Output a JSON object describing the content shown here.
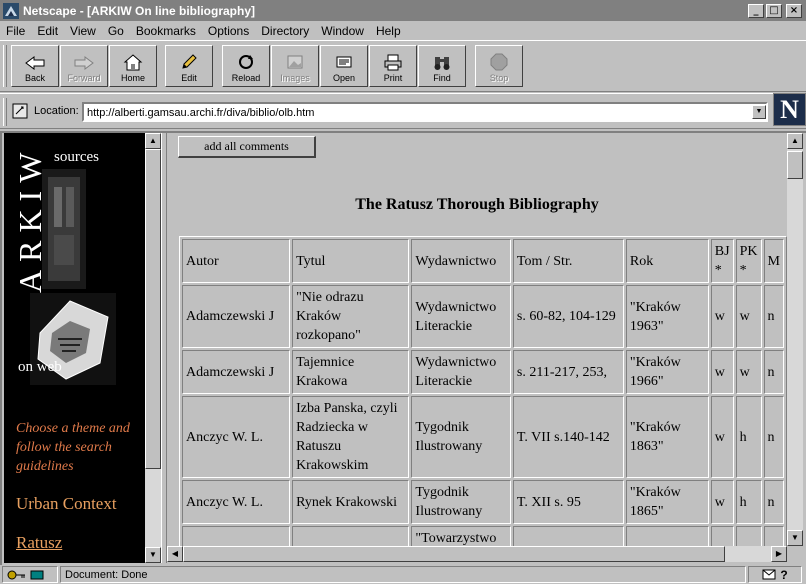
{
  "window": {
    "title": "Netscape - [ARKIW On line bibliography]",
    "min": "_",
    "max": "□",
    "close": "×"
  },
  "menu": [
    "File",
    "Edit",
    "View",
    "Go",
    "Bookmarks",
    "Options",
    "Directory",
    "Window",
    "Help"
  ],
  "toolbar": {
    "back": "Back",
    "forward": "Forward",
    "home": "Home",
    "edit": "Edit",
    "reload": "Reload",
    "images": "Images",
    "open": "Open",
    "print": "Print",
    "find": "Find",
    "stop": "Stop"
  },
  "location": {
    "label": "Location:",
    "url": "http://alberti.gamsau.archi.fr/diva/biblio/olb.htm"
  },
  "brand": {
    "logo_letter": "N"
  },
  "left_frame": {
    "logo_word": "ARKIW",
    "sources": "sources",
    "on_web": "on web",
    "choose_text": "Choose a theme and follow the search guidelines",
    "urban_context": "Urban Context",
    "ratusz": "Ratusz",
    "accent_color": "#e8a060"
  },
  "main": {
    "add_comments": "add all comments",
    "title": "The Ratusz Thorough Bibliography",
    "columns": [
      "Autor",
      "Tytul",
      "Wydawnictwo",
      "Tom / Str.",
      "Rok",
      "BJ *",
      "PK *",
      "M"
    ],
    "rows": [
      [
        "Adamczewski J",
        "\"Nie odrazu Kraków rozkopano\"",
        "Wydawnictwo Literackie",
        "s. 60-82, 104-129",
        "\"Kraków 1963\"",
        "w",
        "w",
        "n"
      ],
      [
        "Adamczewski J",
        "Tajemnice Krakowa",
        "Wydawnictwo Literackie",
        "s. 211-217, 253,",
        "\"Kraków 1966\"",
        "w",
        "w",
        "n"
      ],
      [
        "Anczyc W. L.",
        "Izba Panska, czyli Radziecka w Ratuszu Krakowskim",
        "Tygodnik Ilustrowany",
        "T. VII s.140-142",
        "\"Kraków 1863\"",
        "w",
        "h",
        "n"
      ],
      [
        "Anczyc W. L.",
        "Rynek Krakowski",
        "Tygodnik Ilustrowany",
        "T. XII s. 95",
        "\"Kraków 1865\"",
        "w",
        "h",
        "n"
      ],
      [
        "",
        "",
        "\"Towarzystwo Milosników",
        "",
        "",
        "",
        "",
        ""
      ]
    ]
  },
  "status": {
    "text": "Document: Done"
  }
}
